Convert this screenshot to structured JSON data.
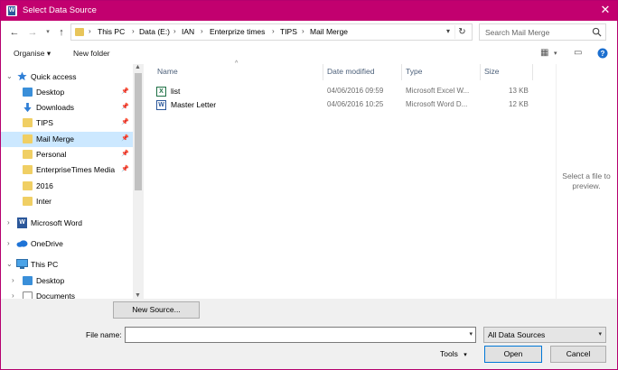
{
  "window": {
    "title": "Select Data Source",
    "accent": "#c2006f"
  },
  "address": {
    "crumbs": [
      "This PC",
      "Data (E:)",
      "IAN",
      "Enterprize times",
      "TIPS",
      "Mail Merge"
    ]
  },
  "search": {
    "placeholder": "Search Mail Merge"
  },
  "toolbar": {
    "organise": "Organise ▾",
    "new_folder": "New folder"
  },
  "nav": {
    "quick_access": "Quick access",
    "items": [
      {
        "label": "Desktop"
      },
      {
        "label": "Downloads"
      },
      {
        "label": "TIPS"
      },
      {
        "label": "Mail Merge"
      },
      {
        "label": "Personal"
      },
      {
        "label": "EnterpriseTimes Media"
      },
      {
        "label": "2016"
      },
      {
        "label": "Inter"
      }
    ],
    "microsoft_word": "Microsoft Word",
    "onedrive": "OneDrive",
    "this_pc": "This PC",
    "pc_items": [
      {
        "label": "Desktop"
      },
      {
        "label": "Documents"
      }
    ]
  },
  "columns": {
    "name": "Name",
    "date": "Date modified",
    "type": "Type",
    "size": "Size"
  },
  "files": [
    {
      "name": "list",
      "date": "04/06/2016 09:59",
      "type": "Microsoft Excel W...",
      "size": "13 KB",
      "icon": "excel-icon"
    },
    {
      "name": "Master Letter",
      "date": "04/06/2016 10:25",
      "type": "Microsoft Word D...",
      "size": "12 KB",
      "icon": "word-icon"
    }
  ],
  "preview": {
    "message": "Select a file to preview."
  },
  "bottom": {
    "new_source": "New Source...",
    "file_name_label": "File name:",
    "file_name_value": "",
    "filter": "All Data Sources",
    "tools": "Tools",
    "open": "Open",
    "cancel": "Cancel"
  }
}
